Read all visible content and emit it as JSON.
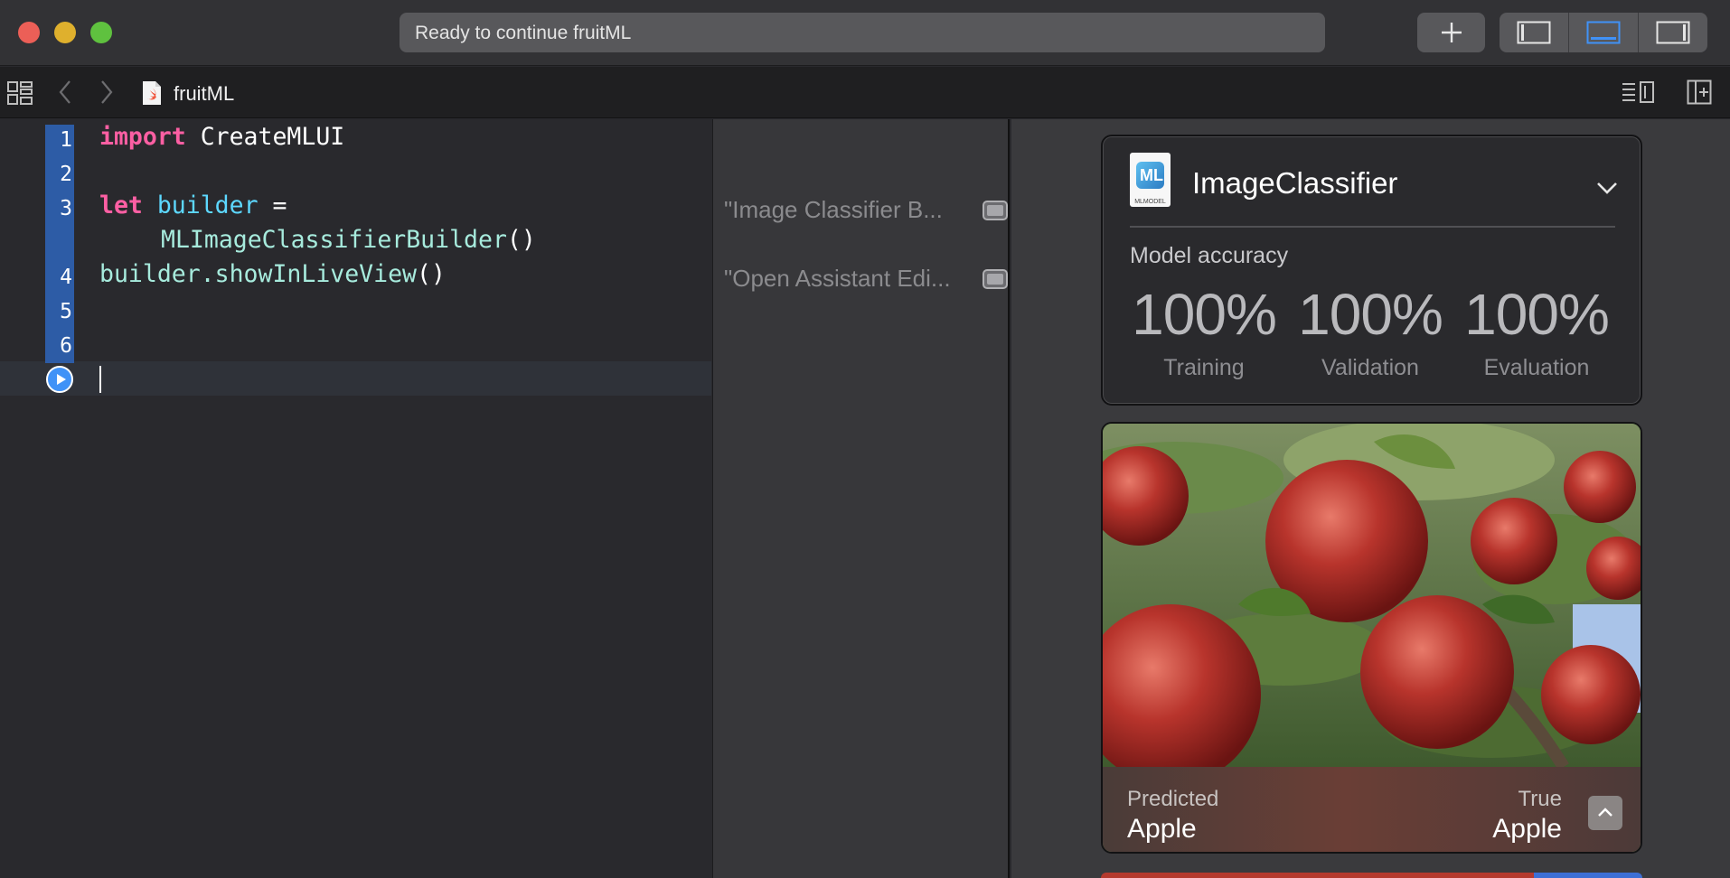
{
  "window": {
    "activity_text": "Ready to continue fruitML"
  },
  "jumpbar": {
    "file_name": "fruitML"
  },
  "editor": {
    "line_numbers": [
      "1",
      "2",
      "3",
      "4",
      "5",
      "6"
    ],
    "lines": [
      {
        "keyword": "import",
        "rest": " CreateMLUI"
      },
      {
        "keyword": "let",
        "var": "builder",
        "rest": " ="
      },
      {
        "fn": "MLImageClassifierBuilder",
        "rest": "()"
      },
      {
        "obj": "builder.",
        "fn": "showInLiveView",
        "rest": "()"
      }
    ]
  },
  "results": [
    {
      "text": "\"Image Classifier B..."
    },
    {
      "text": "\"Open Assistant Edi..."
    }
  ],
  "live_view": {
    "title": "ImageClassifier",
    "icon_caption": "MLMODEL",
    "icon_glyph": "ML",
    "accuracy_label": "Model accuracy",
    "metrics": [
      {
        "value": "100%",
        "name": "Training"
      },
      {
        "value": "100%",
        "name": "Validation"
      },
      {
        "value": "100%",
        "name": "Evaluation"
      }
    ],
    "prediction": {
      "predicted_label": "Predicted",
      "predicted_value": "Apple",
      "true_label": "True",
      "true_value": "Apple"
    }
  },
  "colors": {
    "keyword": "#fc5fa3",
    "variable": "#5dd8ff",
    "function": "#a7ebdd",
    "accent": "#4092f7"
  }
}
